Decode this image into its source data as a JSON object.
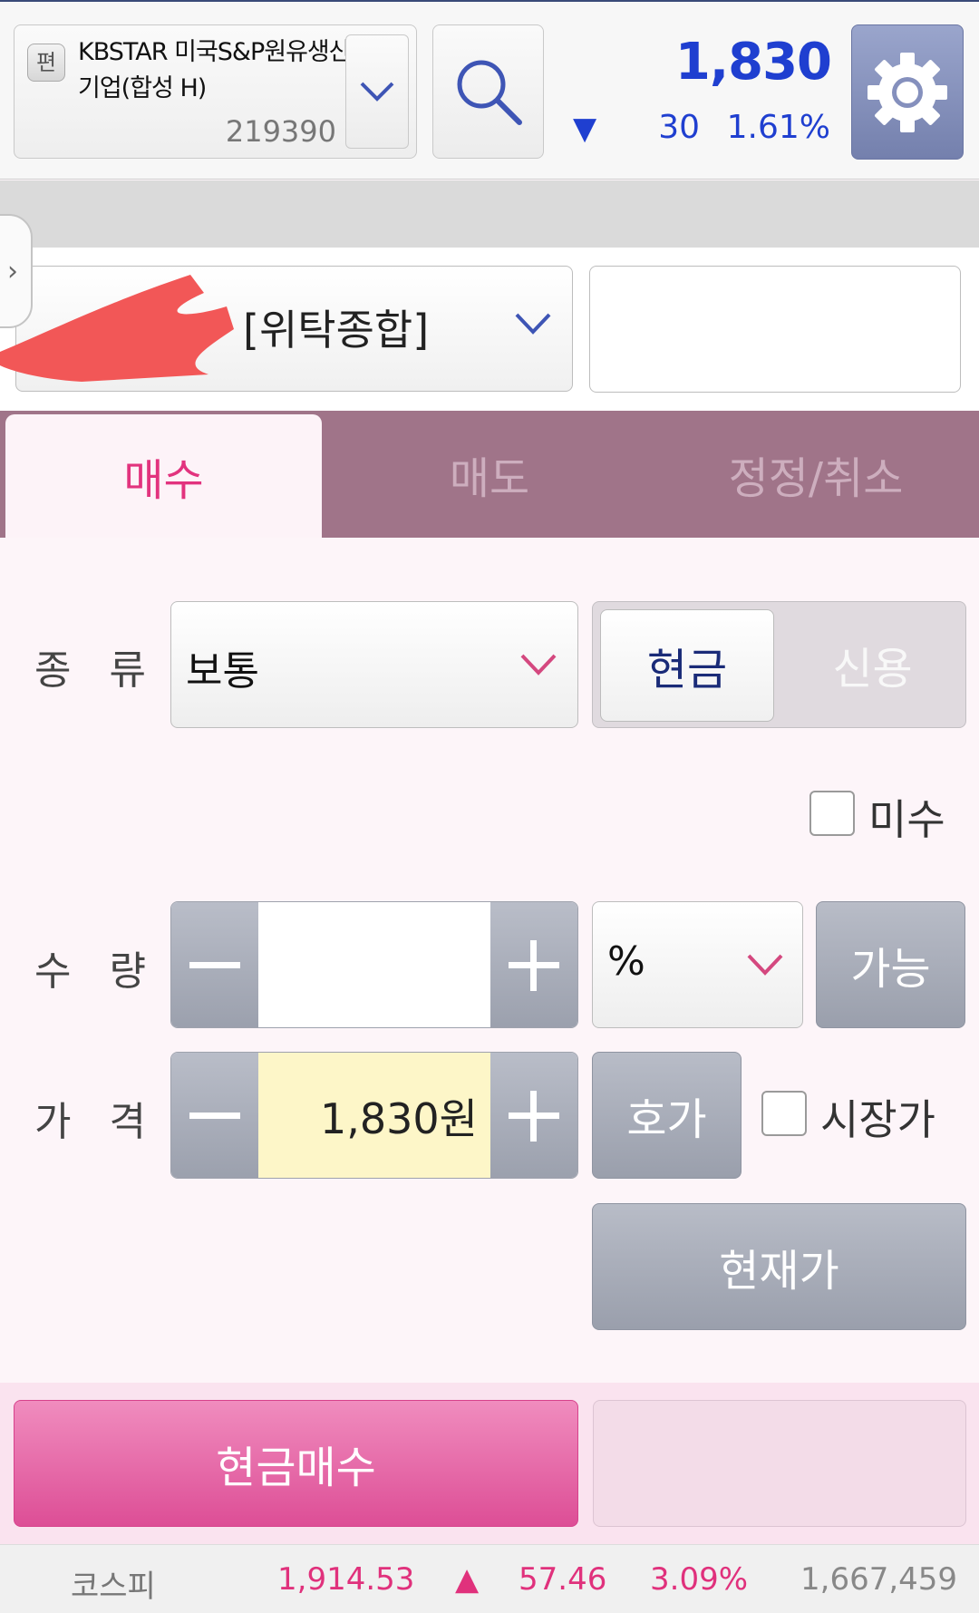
{
  "header": {
    "edit_badge": "편",
    "stock_name": "KBSTAR 미국S&P원유생산기업(합성 H)",
    "stock_code": "219390",
    "price": "1,830",
    "change_arrow": "▼",
    "change": "30",
    "change_rate": "1.61%",
    "price_color": "#1f3fd0"
  },
  "account": {
    "type_label": "[위탁종합]",
    "password_value": ""
  },
  "tabs": [
    {
      "label": "매수",
      "active": true
    },
    {
      "label": "매도",
      "active": false
    },
    {
      "label": "정정/취소",
      "active": false
    }
  ],
  "form": {
    "kind_label": "종 류",
    "kind_value": "보통",
    "cash_label": "현금",
    "credit_label": "신용",
    "misu_label": "미수",
    "qty_label": "수 량",
    "qty_value": "",
    "qty_unit": "%",
    "possible_label": "가능",
    "price_label": "가 격",
    "price_value": "1,830원",
    "hoga_label": "호가",
    "market_label": "시장가",
    "current_price_label": "현재가"
  },
  "actions": {
    "buy_label": "현금매수"
  },
  "index": {
    "name": "코스피",
    "value": "1,914.53",
    "arrow": "▲",
    "change": "57.46",
    "rate": "3.09%",
    "volume": "1,667,459",
    "up_color": "#e0317c"
  },
  "icons": {
    "search": "search-icon",
    "settings": "gear-icon",
    "dropdown": "chevron-down-icon",
    "side": "chevron-right-icon"
  }
}
